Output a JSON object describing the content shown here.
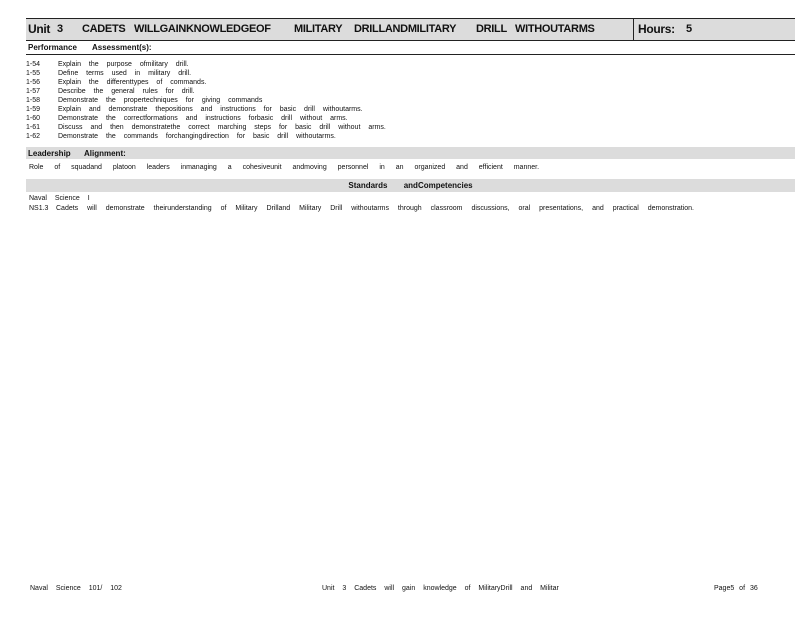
{
  "unit_header": {
    "unit_label": "Unit",
    "unit_number": "3",
    "cadets": "CADETS",
    "will_gain": "WILLGAINKNOWLEDGEOF",
    "military": "MILITARY",
    "drill_and_military": "DRILLANDMILITARY",
    "drill": "DRILL",
    "without_arms": "WITHOUTARMS",
    "hours_label": "Hours:",
    "hours_value": "5"
  },
  "performance_bar": {
    "performance_label": "Performance",
    "assessment_label": "Assessment(s):"
  },
  "tasks": [
    {
      "code": "1-54",
      "text": "Explain the purpose ofmilitary drill."
    },
    {
      "code": "1-55",
      "text": "Define terms used in military drill."
    },
    {
      "code": "1-56",
      "text": "Explain the differenttypes of commands."
    },
    {
      "code": "1-57",
      "text": "Describe the general rules for drill."
    },
    {
      "code": "1-58",
      "text": "Demonstrate the propertechniques for giving commands"
    },
    {
      "code": "1-59",
      "text": "Explain and demonstrate thepositions and instructions for basic drill withoutarms."
    },
    {
      "code": "1-60",
      "text": "Demonstrate the correctformations and instructions forbasic drill without arms."
    },
    {
      "code": "1-61",
      "text": "Discuss and then demonstratethe correct marching steps for basic drill without arms."
    },
    {
      "code": "1-62",
      "text": "Demonstrate the commands forchangingdirection for basic drill withoutarms."
    }
  ],
  "leadership_bar": {
    "leadership_label": "Leadership",
    "alignment_label": "Alignment:"
  },
  "role_text": "Role of squadand platoon leaders inmanaging a cohesiveunit andmoving personnel in an organized and efficient manner.",
  "standards_bar": {
    "title": "Standards andCompetencies"
  },
  "naval_science_line": "Naval Science I",
  "ns_line": {
    "code": "NS1.3",
    "text": "Cadets will demonstrate theirunderstanding of Military Drilland Military Drill withoutarms through classroom discussions, oral presentations, and practical demonstration."
  },
  "footer": {
    "left": "Naval Science 101/ 102",
    "center": "Unit 3 Cadets will gain knowledge of MilitaryDrill and Militar",
    "right": "Page5 of 36"
  }
}
